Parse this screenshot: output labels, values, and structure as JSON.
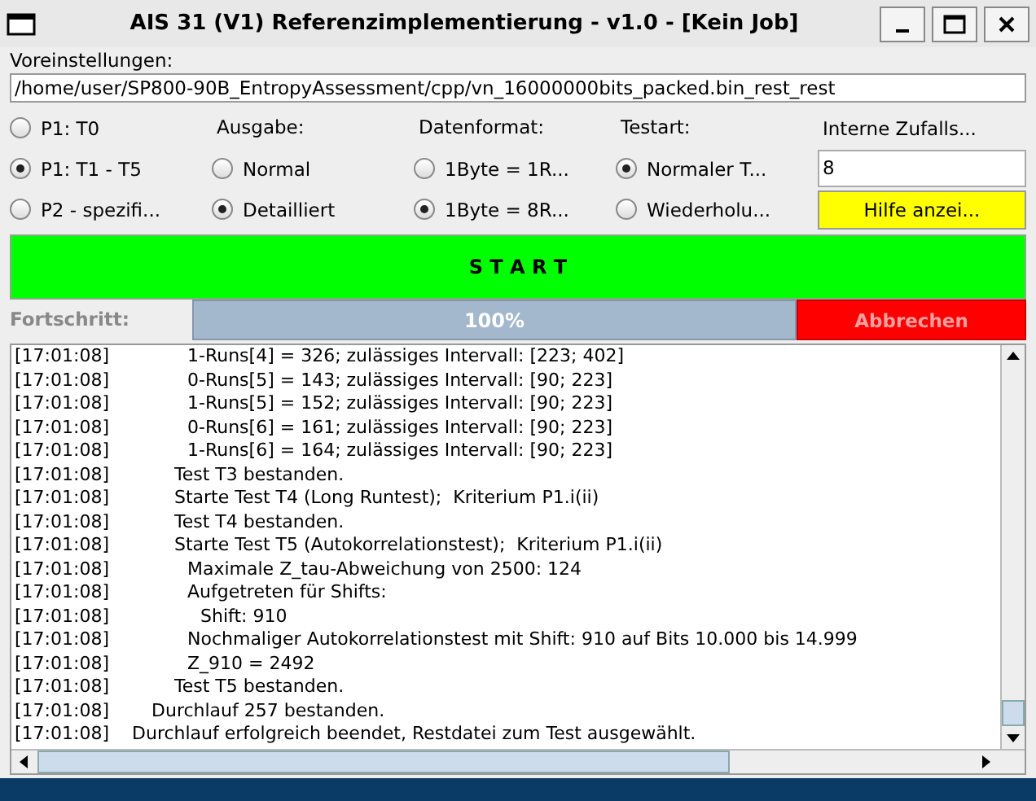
{
  "window": {
    "title": "AIS 31 (V1) Referenzimplementierung - v1.0  - [Kein Job]"
  },
  "presets": {
    "label": "Voreinstellungen:",
    "path": "/home/user/SP800-90B_EntropyAssessment/cpp/vn_16000000bits_packed.bin_rest_rest"
  },
  "columns": [
    {
      "options": [
        {
          "label": "P1: T0",
          "selected": false
        },
        {
          "label": "P1: T1 - T5",
          "selected": true
        },
        {
          "label": "P2 - spezifi...",
          "selected": false
        }
      ]
    },
    {
      "heading": "Ausgabe:",
      "options": [
        {
          "label": "Normal",
          "selected": false
        },
        {
          "label": "Detailliert",
          "selected": true
        }
      ]
    },
    {
      "heading": "Datenformat:",
      "options": [
        {
          "label": "1Byte = 1R...",
          "selected": false
        },
        {
          "label": "1Byte = 8R...",
          "selected": true
        }
      ]
    },
    {
      "heading": "Testart:",
      "options": [
        {
          "label": "Normaler T...",
          "selected": true
        },
        {
          "label": "Wiederholu...",
          "selected": false
        }
      ]
    }
  ],
  "internal": {
    "heading": "Interne Zufalls...",
    "value": "8",
    "help_button": "Hilfe anzei..."
  },
  "start_button": "S T A R T",
  "progress": {
    "label": "Fortschritt:",
    "level": 1,
    "reading": "100%",
    "cancel_button": "Abbrechen"
  },
  "log": [
    {
      "time": "[17:01:08]",
      "kind": "detail",
      "text": "1-Runs[4] = 326; zulässiges Intervall: [223; 402]"
    },
    {
      "time": "[17:01:08]",
      "kind": "detail",
      "text": "0-Runs[5] = 143; zulässiges Intervall: [90; 223]"
    },
    {
      "time": "[17:01:08]",
      "kind": "detail",
      "text": "1-Runs[5] = 152; zulässiges Intervall: [90; 223]"
    },
    {
      "time": "[17:01:08]",
      "kind": "detail",
      "text": "0-Runs[6] = 161; zulässiges Intervall: [90; 223]"
    },
    {
      "time": "[17:01:08]",
      "kind": "detail",
      "text": "1-Runs[6] = 164; zulässiges Intervall: [90; 223]"
    },
    {
      "time": "[17:01:08]",
      "kind": "test",
      "text": "Test T3 bestanden."
    },
    {
      "time": "[17:01:08]",
      "kind": "test",
      "text": "Starte Test T4 (Long Runtest);  Kriterium P1.i(ii)"
    },
    {
      "time": "[17:01:08]",
      "kind": "test",
      "text": "Test T4 bestanden."
    },
    {
      "time": "[17:01:08]",
      "kind": "test",
      "text": "Starte Test T5 (Autokorrelationstest);  Kriterium P1.i(ii)"
    },
    {
      "time": "[17:01:08]",
      "kind": "detail",
      "text": "Maximale Z_tau-Abweichung von 2500: 124"
    },
    {
      "time": "[17:01:08]",
      "kind": "detail",
      "text": "Aufgetreten für Shifts:"
    },
    {
      "time": "[17:01:08]",
      "kind": "subdetail",
      "text": "Shift: 910"
    },
    {
      "time": "[17:01:08]",
      "kind": "detail",
      "text": "Nochmaliger Autokorrelationstest mit Shift: 910 auf Bits 10.000 bis 14.999"
    },
    {
      "time": "[17:01:08]",
      "kind": "detail",
      "text": "Z_910 = 2492"
    },
    {
      "time": "[17:01:08]",
      "kind": "test",
      "text": "Test T5 bestanden."
    },
    {
      "time": "[17:01:08]",
      "kind": "run",
      "text": "Durchlauf 257 bestanden."
    },
    {
      "time": "[17:01:08]",
      "kind": "summary",
      "text": "Durchlauf erfolgreich beendet, Restdatei zum Test ausgewählt."
    }
  ]
}
